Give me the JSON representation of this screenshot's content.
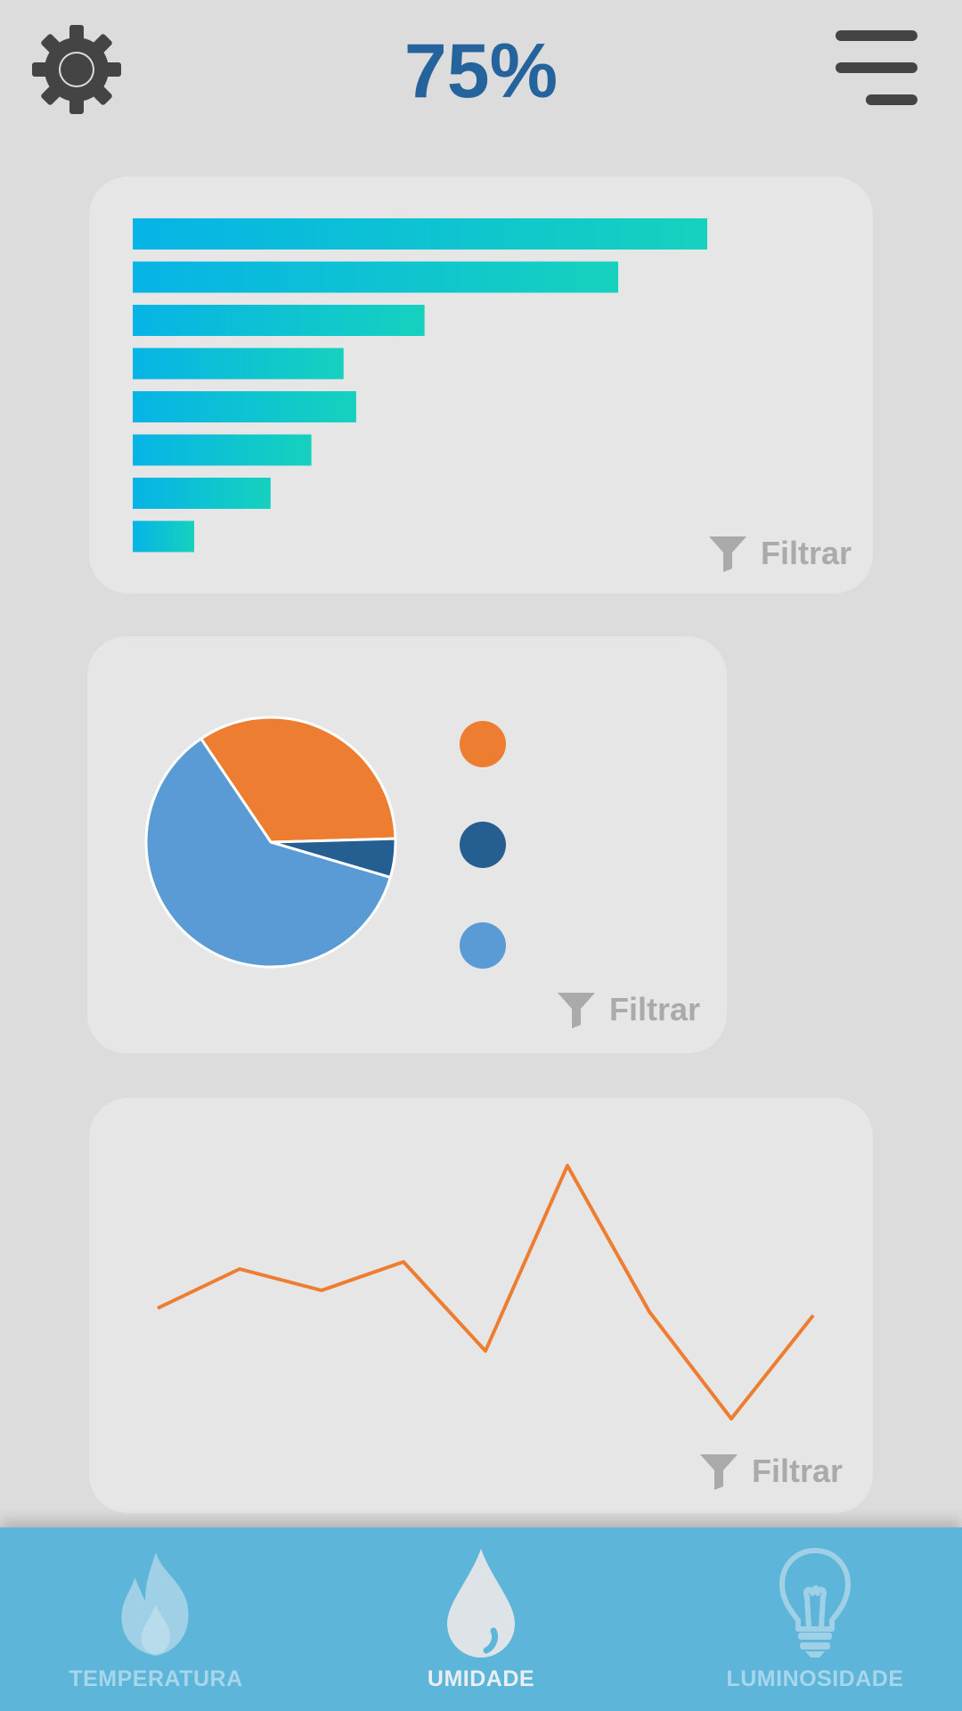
{
  "header": {
    "title": "75%",
    "settings_icon": "gear-icon",
    "menu_icon": "hamburger-menu-icon"
  },
  "colors": {
    "title": "#24639c",
    "bar_gradient_start": "#06b4e6",
    "bar_gradient_end": "#16d1be",
    "pie_orange": "#ed7d31",
    "pie_dark_blue": "#255e91",
    "pie_light_blue": "#5b9bd5",
    "line": "#ed7d31",
    "nav_background": "#5db6da"
  },
  "cards": {
    "bar_filter_label": "Filtrar",
    "pie_filter_label": "Filtrar",
    "line_filter_label": "Filtrar",
    "filter_icon": "funnel-icon"
  },
  "chart_data": [
    {
      "type": "bar",
      "orientation": "horizontal",
      "values": [
        100,
        84.5,
        50.8,
        36.7,
        38.9,
        31.1,
        24.0,
        10.7
      ],
      "xlim": [
        0,
        100
      ],
      "grid": false
    },
    {
      "type": "pie",
      "slices": [
        {
          "value": 34,
          "color": "#ed7d31"
        },
        {
          "value": 5,
          "color": "#255e91"
        },
        {
          "value": 61,
          "color": "#5b9bd5"
        }
      ],
      "legend_position": "right"
    },
    {
      "type": "line",
      "x": [
        1,
        2,
        3,
        4,
        5,
        6,
        7,
        8,
        9,
        10
      ],
      "values": [
        44,
        55,
        49,
        57,
        32,
        84,
        43,
        13,
        42,
        null
      ],
      "ylim": [
        0,
        100
      ],
      "grid": false
    }
  ],
  "bottom_nav": [
    {
      "label": "TEMPERATURA",
      "icon": "flame-icon",
      "active": false
    },
    {
      "label": "UMIDADE",
      "icon": "water-drop-icon",
      "active": true
    },
    {
      "label": "LUMINOSIDADE",
      "icon": "lightbulb-icon",
      "active": false
    }
  ]
}
